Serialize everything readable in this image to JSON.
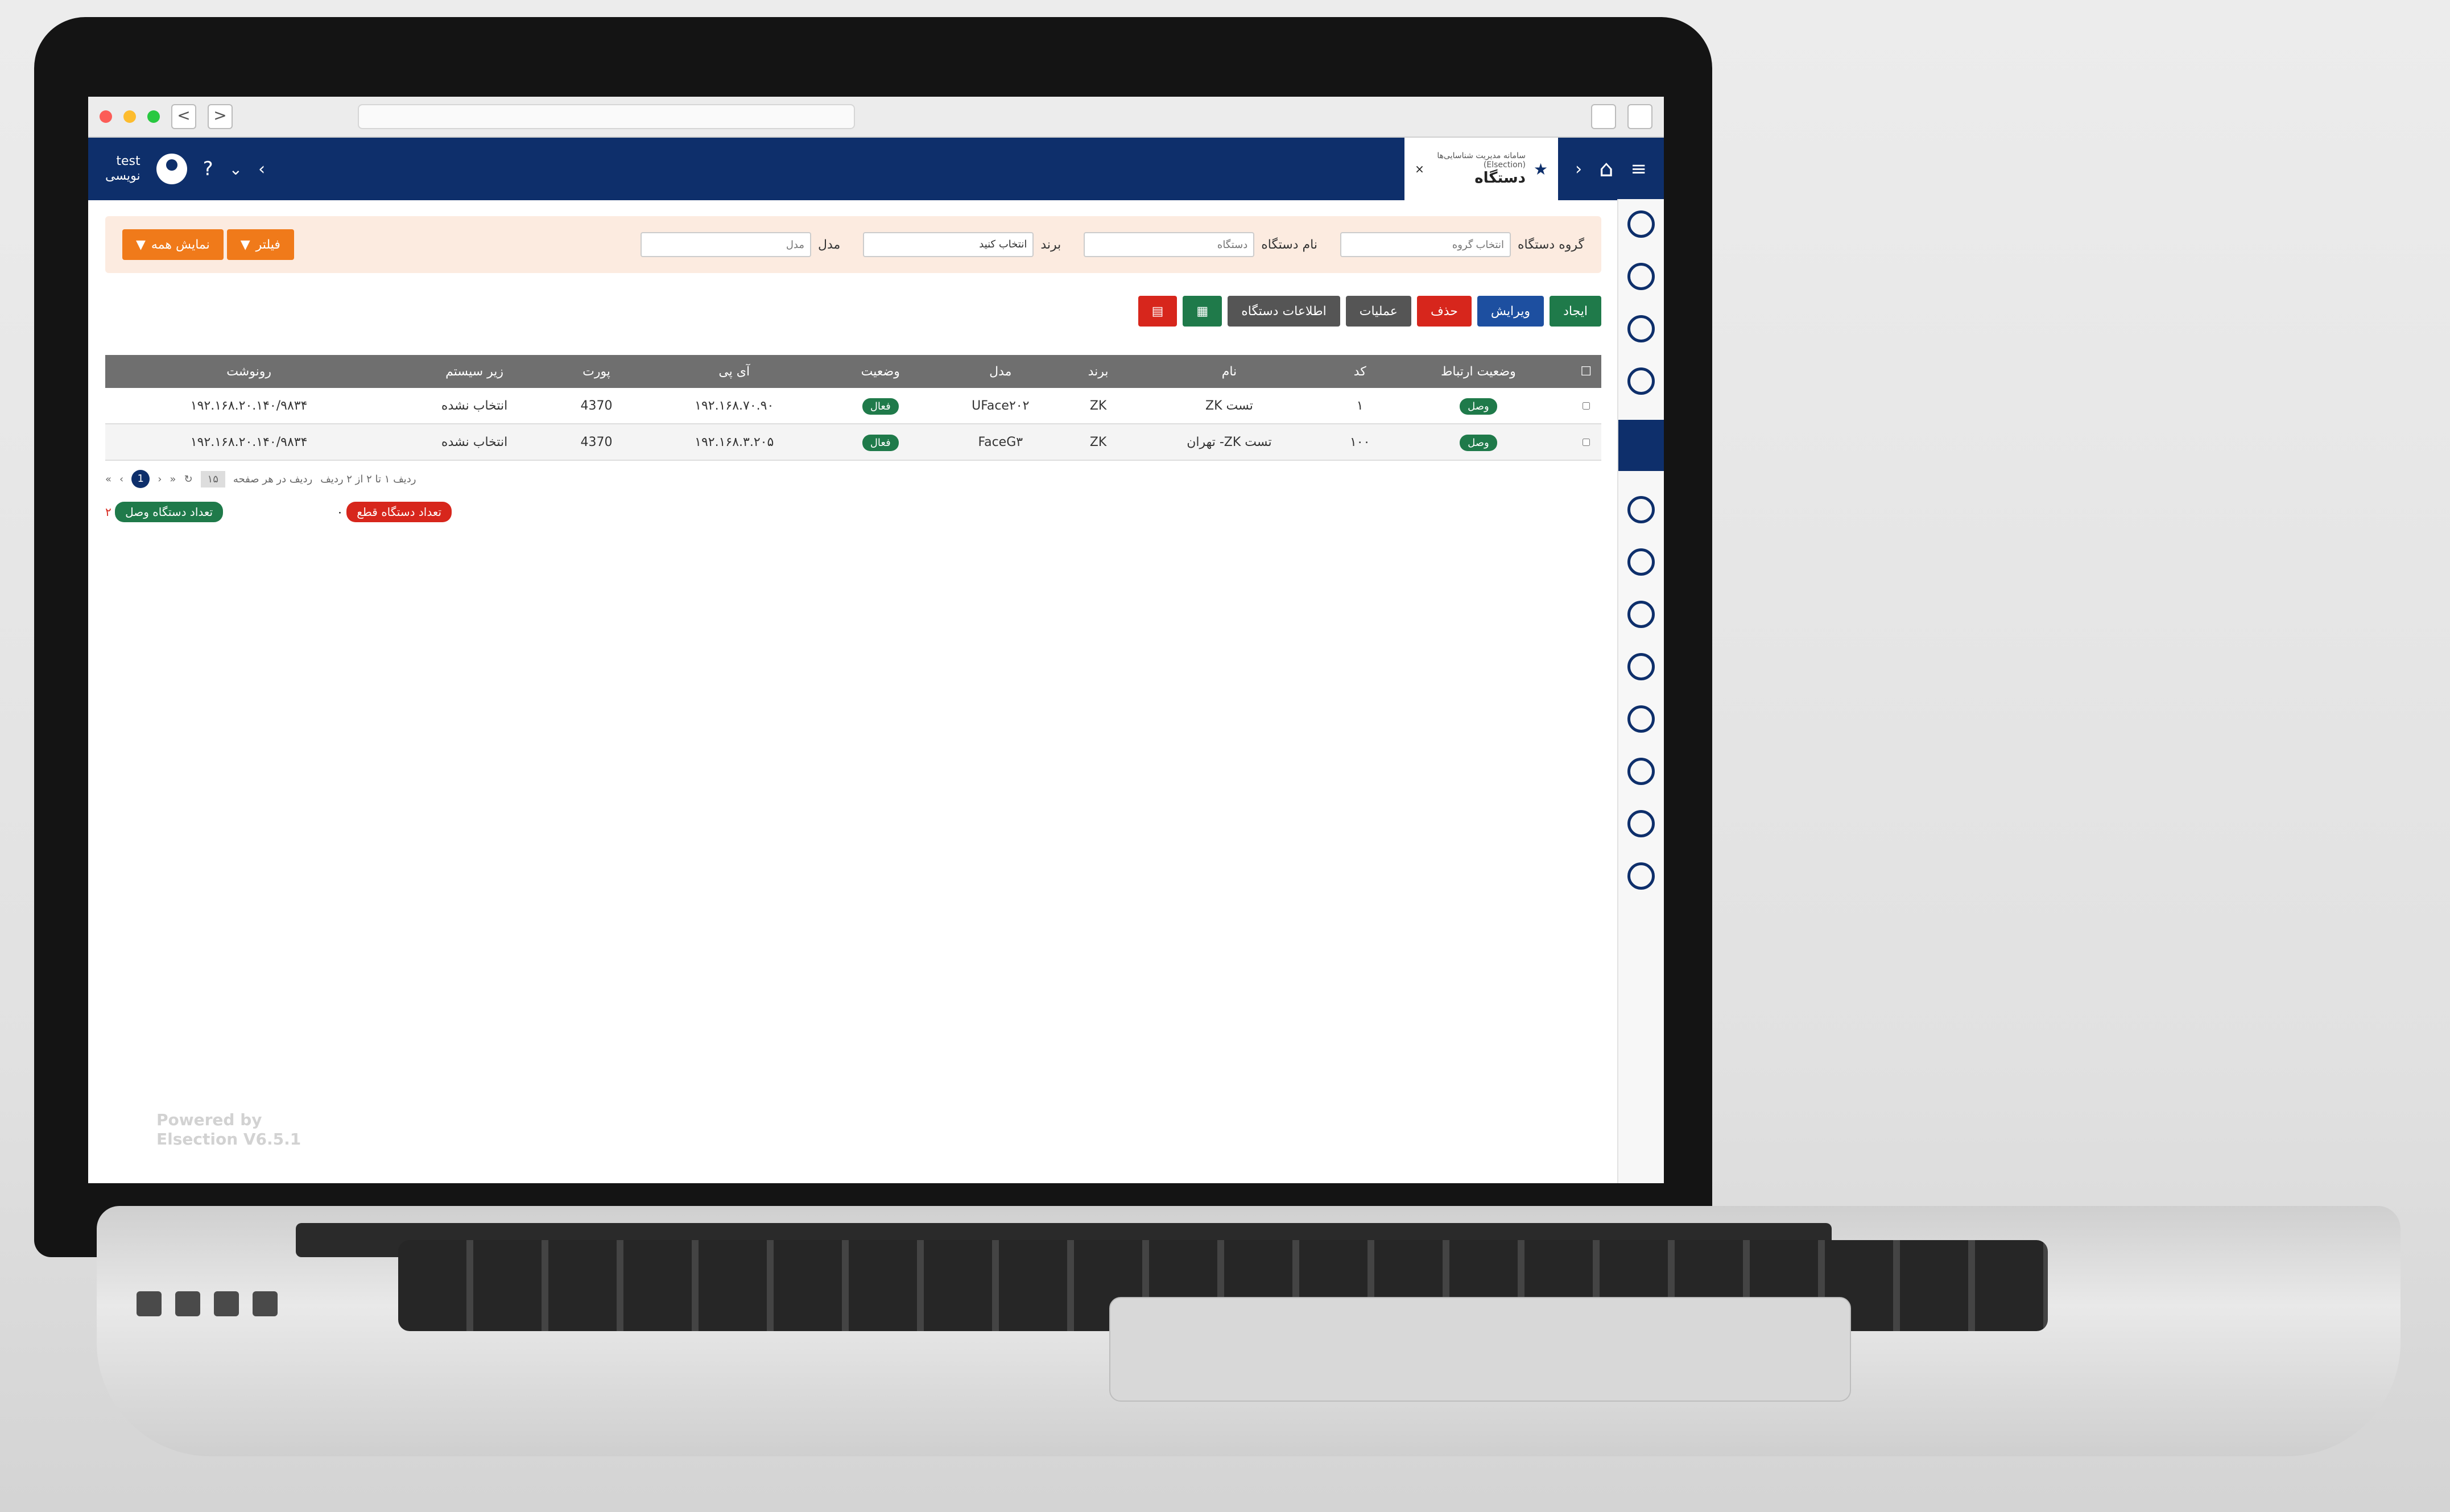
{
  "browser": {
    "back": "<",
    "forward": ">"
  },
  "header": {
    "user_name": "test",
    "user_role": "نویسی",
    "help": "?",
    "tab_title": "دستگاه",
    "tab_subtitle": "سامانه مدیریت شناسایی‌ها (Elsection)",
    "tab_close": "×",
    "menu_icon": "≡"
  },
  "filters": {
    "group_label": "گروه دستگاه",
    "group_placeholder": "انتخاب گروه",
    "name_label": "نام دستگاه",
    "name_placeholder": "دستگاه",
    "brand_label": "برند",
    "brand_value": "انتخاب کنید",
    "model_label": "مدل",
    "model_placeholder": "مدل",
    "filter_btn": "فیلتر",
    "show_all_btn": "نمایش همه"
  },
  "toolbar": {
    "add": "ایجاد",
    "edit": "ویرایش",
    "delete": "حذف",
    "operations": "عملیات",
    "device_info": "اطلاعات دستگاه"
  },
  "table": {
    "headers": [
      "وضعیت ارتباط",
      "کد",
      "نام",
      "برند",
      "مدل",
      "وضعیت",
      "آی پی",
      "پورت",
      "زیر سیستم",
      "رونوشت"
    ],
    "rows": [
      {
        "conn": "وصل",
        "code": "۱",
        "name": "تست ZK",
        "brand": "ZK",
        "model": "UFace۲۰۲",
        "status": "فعال",
        "ip": "۱۹۲.۱۶۸.۷۰.۹۰",
        "port": "4370",
        "subsystem": "انتخاب نشده",
        "copy": "۱۹۲.۱۶۸.۲۰.۱۴۰/۹۸۳۴"
      },
      {
        "conn": "وصل",
        "code": "۱۰۰",
        "name": "تست ZK- تهران",
        "brand": "ZK",
        "model": "FaceG۳",
        "status": "فعال",
        "ip": "۱۹۲.۱۶۸.۳.۲۰۵",
        "port": "4370",
        "subsystem": "انتخاب نشده",
        "copy": "۱۹۲.۱۶۸.۲۰.۱۴۰/۹۸۳۴"
      }
    ]
  },
  "pager": {
    "page": "1",
    "per_page": "۱۵",
    "per_page_label": "ردیف در هر صفحه",
    "range_text": "ردیف ۱ تا ۲ از ۲ ردیف"
  },
  "stats": {
    "connected_label": "تعداد دستگاه وصل",
    "connected_count": "۲",
    "disconnected_label": "تعداد دستگاه قطع",
    "disconnected_count": "۰"
  },
  "footer": {
    "powered_line1": "Powered by",
    "powered_line2": "Elsection V6.5.1"
  },
  "colors": {
    "header_blue": "#0e2f6b",
    "accent_orange": "#f07a1a",
    "green": "#1f7a4a",
    "red": "#d7261c",
    "filter_bg": "#fcebe0"
  }
}
